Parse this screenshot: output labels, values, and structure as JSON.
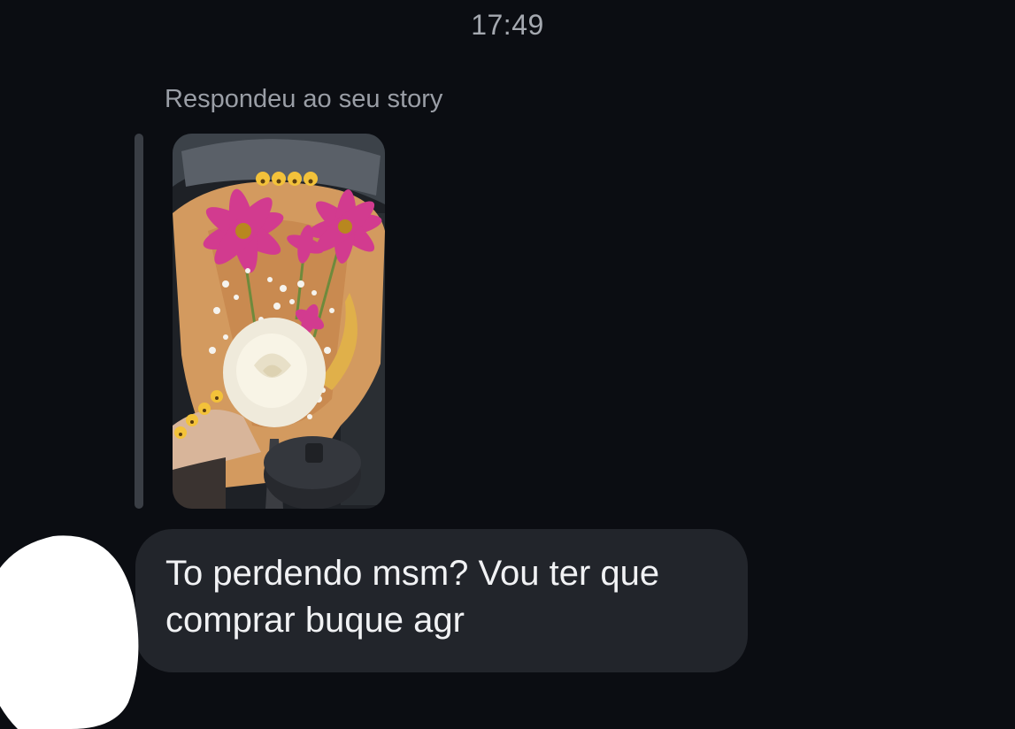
{
  "thread": {
    "timestamp": "17:49",
    "reply_caption": "Respondeu ao seu story",
    "story_preview": {
      "icon": "flower-bouquet-story-image",
      "emoji_top": "😮😮😮😮",
      "emoji_side": "😮😮😮😮"
    },
    "message": {
      "line1": "To perdendo msm? Vou ter que",
      "line2": "comprar buque agr"
    },
    "avatar": {
      "icon": "censored-avatar"
    }
  },
  "colors": {
    "background": "#0b0d12",
    "bubble": "#22252b",
    "reply_bar": "#3a3e45",
    "muted_text": "#9a9ea6"
  }
}
